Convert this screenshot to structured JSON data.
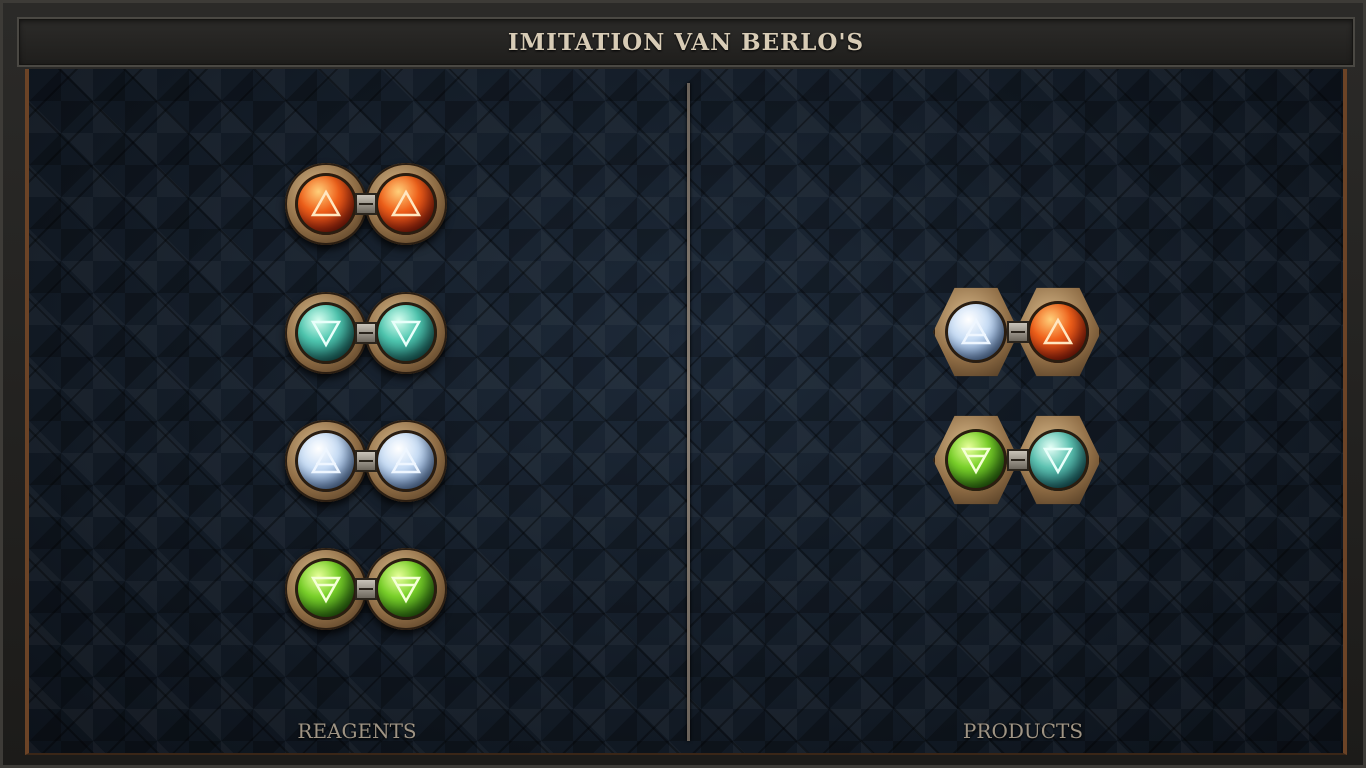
{
  "window": {
    "title": "IMITATION VAN BERLO'S"
  },
  "columns": {
    "reagents_label": "REAGENTS",
    "products_label": "PRODUCTS"
  },
  "reagents": [
    {
      "name": "fire-pair",
      "left": "fire",
      "right": "fire"
    },
    {
      "name": "water-pair",
      "left": "water",
      "right": "water"
    },
    {
      "name": "air-pair",
      "left": "air",
      "right": "air"
    },
    {
      "name": "earth-pair",
      "left": "earth",
      "right": "earth"
    }
  ],
  "products": [
    {
      "name": "air-fire-product",
      "left": "air",
      "right": "fire"
    },
    {
      "name": "earth-water-product",
      "left": "earth",
      "right": "water"
    }
  ],
  "symbols": {
    "fire": "triangle-up-icon",
    "air": "triangle-up-bar-icon",
    "water": "triangle-down-icon",
    "earth": "triangle-down-bar-icon"
  },
  "colors": {
    "frame_wood": "#6b4326",
    "title_text": "#d8ccb6",
    "label_text": "#9f9484",
    "panel_bg": "#121a24"
  }
}
